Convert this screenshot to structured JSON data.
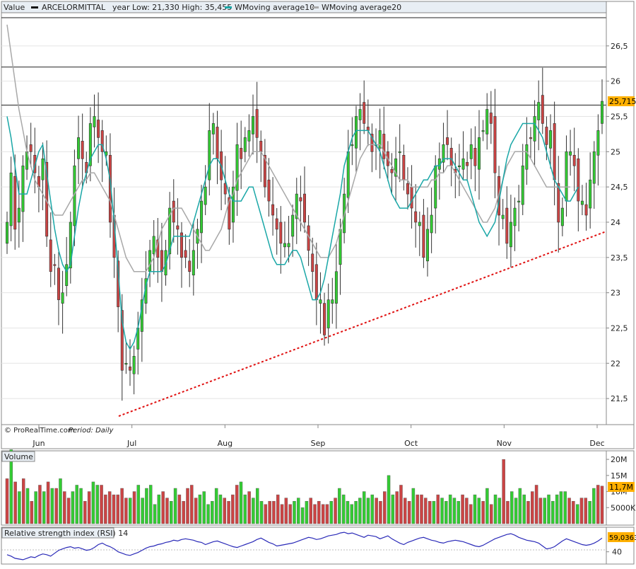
{
  "header": {
    "value_label": "Value",
    "instrument": "ARCELORMITTAL",
    "range_text": "year Low: 21,330 High: 35,455",
    "ma10_label": "WMoving average10",
    "ma20_label": "WMoving average20"
  },
  "watermark": "© ProRealTime.com",
  "period_label": "Period: Daily",
  "colors": {
    "up": "#33cc33",
    "down": "#cc4444",
    "ma10": "#1aa7a7",
    "ma20": "#a8a8a8",
    "rsi": "#2a2ab8",
    "trendline": "#e01010",
    "last_price_bg": "#ffb000"
  },
  "chart_data": [
    {
      "type": "candlestick",
      "name": "price",
      "months": [
        "Jun",
        "Jul",
        "Aug",
        "Sep",
        "Oct",
        "Nov",
        "Dec"
      ],
      "y_ticks": [
        "21,5",
        "22",
        "22,5",
        "23",
        "23,5",
        "24",
        "24,5",
        "25",
        "25,5",
        "26",
        "26,5"
      ],
      "ylim": [
        21.15,
        26.95
      ],
      "last_price": "25,715",
      "horizontal_levels": [
        26.9,
        26.2,
        25.66
      ],
      "trendline": {
        "from": 21.25,
        "to": 23.87
      },
      "close": [
        24.0,
        24.7,
        23.9,
        24.2,
        24.8,
        25.0,
        25.0,
        24.7,
        24.5,
        24.9,
        23.8,
        23.3,
        23.4,
        22.9,
        23.0,
        23.4,
        24.0,
        24.8,
        25.2,
        24.9,
        24.7,
        25.4,
        25.5,
        25.2,
        25.0,
        25.0,
        24.0,
        23.5,
        22.8,
        21.9,
        22.0,
        21.9,
        22.1,
        22.5,
        22.9,
        23.2,
        23.6,
        23.8,
        23.5,
        23.3,
        23.6,
        24.2,
        24.0,
        23.9,
        23.5,
        23.5,
        23.3,
        23.6,
        23.9,
        24.3,
        24.5,
        25.3,
        25.4,
        24.9,
        24.6,
        24.4,
        23.9,
        24.5,
        25.1,
        24.9,
        25.2,
        25.3,
        25.5,
        25.2,
        25.0,
        24.5,
        24.3,
        24.1,
        23.9,
        23.7,
        23.7,
        23.7,
        24.1,
        24.4,
        24.3,
        24.0,
        23.6,
        23.3,
        22.9,
        22.9,
        22.4,
        22.9,
        22.9,
        23.3,
        23.9,
        24.4,
        25.0,
        25.1,
        25.5,
        25.6,
        25.4,
        25.3,
        25.0,
        25.1,
        25.3,
        24.9,
        24.8,
        24.7,
        24.9,
        25.0,
        24.6,
        24.4,
        24.2,
        24.0,
        24.0,
        23.5,
        23.9,
        24.1,
        24.8,
        24.9,
        25.1,
        25.1,
        24.8,
        24.7,
        24.8,
        24.9,
        24.8,
        25.1,
        24.8,
        25.2,
        25.3,
        25.6,
        25.4,
        24.7,
        24.1,
        24.1,
        23.7,
        24.0,
        24.2,
        24.3,
        24.8,
        25.1,
        25.2,
        25.5,
        25.7,
        25.4,
        25.1,
        25.3,
        24.6,
        24.0,
        24.2,
        25.0,
        25.0,
        24.8,
        24.3,
        24.3,
        24.1,
        24.6,
        25.0,
        25.3,
        25.715
      ],
      "ma10": [
        25.5,
        25.2,
        24.8,
        24.4,
        24.4,
        24.4,
        24.6,
        24.8,
        25.0,
        25.1,
        24.7,
        24.3,
        23.9,
        23.6,
        23.4,
        23.3,
        23.4,
        23.8,
        24.2,
        24.5,
        24.7,
        24.9,
        25.0,
        25.1,
        25.1,
        24.9,
        24.6,
        24.0,
        23.3,
        22.6,
        22.3,
        22.2,
        22.3,
        22.5,
        22.8,
        23.1,
        23.3,
        23.3,
        23.3,
        23.3,
        23.4,
        23.6,
        23.8,
        23.8,
        23.8,
        23.8,
        23.8,
        24.0,
        24.2,
        24.4,
        24.6,
        24.8,
        24.9,
        24.9,
        24.8,
        24.6,
        24.4,
        24.3,
        24.3,
        24.3,
        24.4,
        24.5,
        24.5,
        24.3,
        24.1,
        23.9,
        23.7,
        23.5,
        23.4,
        23.4,
        23.4,
        23.5,
        23.6,
        23.6,
        23.5,
        23.3,
        23.1,
        22.9,
        22.9,
        23.0,
        23.2,
        23.5,
        23.8,
        24.1,
        24.4,
        24.8,
        25.0,
        25.2,
        25.3,
        25.3,
        25.3,
        25.3,
        25.2,
        25.1,
        25.0,
        24.8,
        24.6,
        24.4,
        24.3,
        24.2,
        24.2,
        24.2,
        24.3,
        24.4,
        24.5,
        24.6,
        24.6,
        24.7,
        24.8,
        24.8,
        24.9,
        24.9,
        24.9,
        24.8,
        24.7,
        24.6,
        24.6,
        24.4,
        24.2,
        24.0,
        23.9,
        23.8,
        23.9,
        24.0,
        24.3,
        24.6,
        24.9,
        25.1,
        25.2,
        25.3,
        25.4,
        25.4,
        25.4,
        25.4,
        25.3,
        25.2,
        25.0,
        24.8,
        24.6,
        24.5,
        24.4,
        24.3,
        24.3,
        24.4,
        24.5
      ],
      "ma20": [
        26.8,
        26.4,
        26.0,
        25.6,
        25.3,
        25.0,
        24.8,
        24.6,
        24.5,
        24.4,
        24.3,
        24.2,
        24.1,
        24.1,
        24.1,
        24.2,
        24.3,
        24.4,
        24.5,
        24.6,
        24.6,
        24.7,
        24.7,
        24.6,
        24.5,
        24.4,
        24.3,
        24.1,
        23.9,
        23.7,
        23.5,
        23.4,
        23.3,
        23.3,
        23.3,
        23.3,
        23.4,
        23.5,
        23.7,
        23.9,
        24.0,
        24.1,
        24.2,
        24.2,
        24.2,
        24.1,
        24.0,
        23.9,
        23.8,
        23.7,
        23.6,
        23.6,
        23.7,
        23.8,
        23.9,
        24.1,
        24.3,
        24.4,
        24.6,
        24.7,
        24.8,
        24.9,
        25.0,
        25.0,
        25.0,
        24.9,
        24.8,
        24.7,
        24.6,
        24.5,
        24.4,
        24.3,
        24.2,
        24.1,
        24.0,
        23.9,
        23.8,
        23.7,
        23.6,
        23.5,
        23.5,
        23.5,
        23.6,
        23.7,
        23.9,
        24.1,
        24.3,
        24.5,
        24.7,
        24.9,
        25.0,
        25.1,
        25.1,
        25.1,
        25.1,
        25.0,
        24.9,
        24.8,
        24.7,
        24.6,
        24.6,
        24.6,
        24.5,
        24.5,
        24.5,
        24.5,
        24.5,
        24.6,
        24.6,
        24.7,
        24.7,
        24.8,
        24.8,
        24.7,
        24.6,
        24.5,
        24.4,
        24.3,
        24.2,
        24.1,
        24.0,
        24.0,
        24.1,
        24.2,
        24.4,
        24.6,
        24.8,
        24.9,
        25.0,
        25.0,
        25.0,
        25.0,
        24.9,
        24.8,
        24.7,
        24.6,
        24.5,
        24.5,
        24.5,
        24.5,
        24.5,
        24.5,
        24.5
      ],
      "ma10_end": 24.56,
      "ma20_end": 24.6
    },
    {
      "type": "bar",
      "name": "Volume",
      "title": "Volume",
      "y_ticks": [
        "20M",
        "15M",
        "10M",
        "5000K"
      ],
      "ylim": [
        0,
        22
      ],
      "last_value": "11,7M",
      "values": [
        14,
        23,
        13,
        10,
        14,
        11,
        7,
        10,
        12,
        10,
        13,
        11,
        11,
        14,
        10,
        8,
        10,
        12,
        11,
        7,
        10,
        13,
        12,
        12,
        9,
        10,
        9,
        9,
        11,
        8,
        8,
        10,
        12,
        8,
        11,
        12,
        6,
        9,
        10,
        8,
        7,
        11,
        9,
        7,
        11,
        12,
        8,
        9,
        10,
        6,
        7,
        11,
        9,
        8,
        7,
        9,
        12,
        13,
        9,
        10,
        8,
        11,
        7,
        6,
        7,
        7,
        9,
        6,
        8,
        6,
        7,
        8,
        5,
        7,
        8,
        6,
        7,
        6,
        6,
        7,
        8,
        11,
        9,
        7,
        6,
        7,
        8,
        10,
        8,
        9,
        8,
        7,
        10,
        15,
        9,
        10,
        12,
        8,
        7,
        11,
        9,
        9,
        8,
        7,
        7,
        9,
        8,
        7,
        9,
        8,
        7,
        9,
        8,
        6,
        9,
        8,
        7,
        11,
        6,
        9,
        8,
        20,
        7,
        10,
        8,
        11,
        9,
        7,
        10,
        12,
        8,
        8,
        9,
        7,
        9,
        10,
        10,
        8,
        7,
        6,
        8,
        8,
        7,
        11,
        12,
        11.7
      ],
      "up": [
        0,
        1,
        0,
        1,
        0,
        1,
        0,
        1,
        0,
        1,
        0,
        1,
        0,
        1,
        0,
        0,
        1,
        1,
        1,
        0,
        0,
        1,
        1,
        0,
        0,
        0,
        0,
        0,
        0,
        0,
        1,
        0,
        1,
        1,
        1,
        1,
        1,
        1,
        0,
        0,
        1,
        1,
        0,
        0,
        0,
        0,
        0,
        1,
        1,
        1,
        1,
        1,
        1,
        0,
        0,
        0,
        0,
        1,
        1,
        0,
        1,
        1,
        1,
        0,
        0,
        0,
        0,
        0,
        0,
        0,
        1,
        1,
        1,
        1,
        0,
        0,
        0,
        0,
        0,
        1,
        0,
        1,
        1,
        1,
        1,
        1,
        1,
        1,
        1,
        1,
        0,
        0,
        0,
        1,
        1,
        0,
        0,
        0,
        0,
        1,
        0,
        0,
        0,
        0,
        1,
        0,
        1,
        1,
        1,
        1,
        1,
        0,
        0,
        0,
        1,
        1,
        0,
        1,
        0,
        1,
        1,
        0,
        0,
        1,
        1,
        1,
        1,
        0,
        0,
        0,
        0,
        1,
        1,
        1,
        1,
        1,
        1,
        0,
        0,
        1,
        0,
        0,
        1,
        1,
        0,
        0,
        0,
        1,
        1,
        1,
        1
      ]
    },
    {
      "type": "line",
      "name": "Relative strength index (RSI) 14",
      "title": "Relative strength index (RSI) 14",
      "y_ticks": [
        "40"
      ],
      "ylim": [
        25,
        72
      ],
      "last_value": "59,0363",
      "values": [
        36,
        34,
        31,
        30,
        29,
        31,
        33,
        32,
        35,
        37,
        36,
        34,
        38,
        42,
        44,
        46,
        47,
        45,
        46,
        44,
        42,
        43,
        46,
        50,
        52,
        49,
        47,
        44,
        40,
        38,
        36,
        35,
        37,
        39,
        42,
        45,
        47,
        48,
        50,
        51,
        53,
        54,
        56,
        55,
        57,
        58,
        57,
        56,
        54,
        53,
        50,
        52,
        54,
        55,
        53,
        51,
        49,
        47,
        46,
        48,
        50,
        52,
        54,
        57,
        59,
        56,
        53,
        51,
        48,
        49,
        50,
        51,
        52,
        54,
        56,
        58,
        60,
        59,
        57,
        58,
        60,
        62,
        63,
        64,
        66,
        67,
        65,
        66,
        64,
        62,
        60,
        63,
        62,
        61,
        58,
        60,
        62,
        58,
        55,
        52,
        50,
        53,
        55,
        57,
        59,
        60,
        58,
        56,
        55,
        53,
        52,
        54,
        55,
        56,
        55,
        54,
        52,
        50,
        48,
        47,
        49,
        52,
        55,
        58,
        60,
        62,
        64,
        65,
        63,
        60,
        58,
        56,
        55,
        54,
        52,
        48,
        44,
        45,
        47,
        51,
        55,
        58,
        56,
        54,
        52,
        50,
        49,
        50,
        52,
        55,
        59
      ]
    }
  ]
}
